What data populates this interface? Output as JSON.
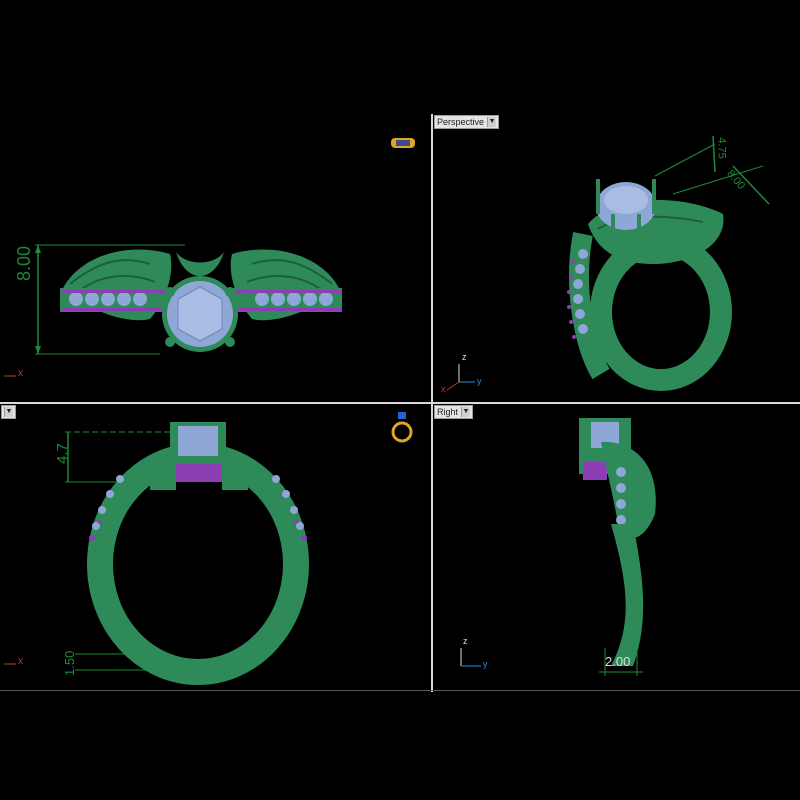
{
  "viewports": {
    "top": {
      "label": "",
      "dimension": "8.00",
      "axis_x": "x"
    },
    "perspective": {
      "label": "Perspective",
      "dim_a": "4.75",
      "dim_b": "8.00",
      "axis_z": "z",
      "axis_x": "x",
      "axis_y": "y"
    },
    "front": {
      "label": "",
      "dim_a": "4.7",
      "dim_b": "1.50",
      "axis_x": "x"
    },
    "right": {
      "label": "Right",
      "dimension": "2.00",
      "axis_z": "z",
      "axis_y": "y"
    }
  },
  "colors": {
    "background": "#000000",
    "metal": "#2f8a5a",
    "gem": "#8fa7d6",
    "prongs": "#8c3fb4",
    "dimension": "#1e8a3a"
  },
  "icons": [
    "ring-top-icon",
    "ring-side-icon"
  ]
}
